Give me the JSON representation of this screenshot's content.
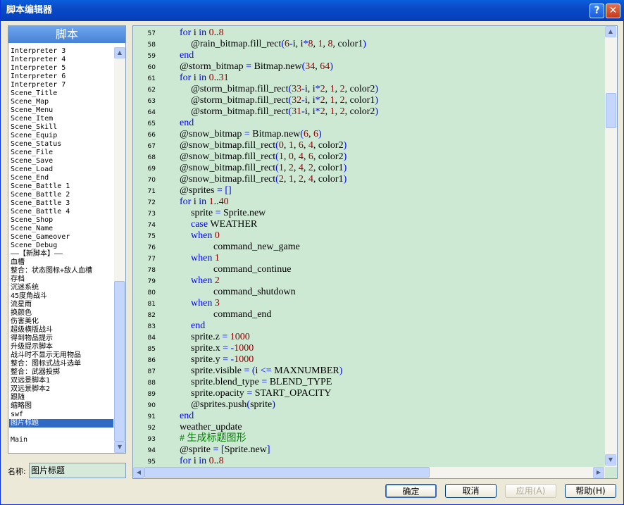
{
  "window": {
    "title": "脚本编辑器",
    "help_icon": "?",
    "close_icon": "✕"
  },
  "script_list": {
    "header": "脚本",
    "items": [
      "Interpreter 3",
      "Interpreter 4",
      "Interpreter 5",
      "Interpreter 6",
      "Interpreter 7",
      "Scene_Title",
      "Scene_Map",
      "Scene_Menu",
      "Scene_Item",
      "Scene_Skill",
      "Scene_Equip",
      "Scene_Status",
      "Scene_File",
      "Scene_Save",
      "Scene_Load",
      "Scene_End",
      "Scene_Battle 1",
      "Scene_Battle 2",
      "Scene_Battle 3",
      "Scene_Battle 4",
      "Scene_Shop",
      "Scene_Name",
      "Scene_Gameover",
      "Scene_Debug",
      "——【新脚本】——",
      "血槽",
      "整合：状态图标+敌人血槽",
      "存档",
      "沉迷系统",
      "45度角战斗",
      "流星雨",
      "换颜色",
      "伤害美化",
      "超级横版战斗",
      "得到物品提示",
      "升级提示脚本",
      "战斗时不显示无用物品",
      "整合：图标式战斗选单",
      "整合：武器投掷",
      "双远景脚本1",
      "双远景脚本2",
      "跟随",
      "缩略图",
      "swf",
      "图片标题",
      "",
      "Main"
    ],
    "selected_index": 44
  },
  "name_field": {
    "label": "名称:",
    "value": "图片标题"
  },
  "code": {
    "lines": [
      {
        "n": "57",
        "indent": 1,
        "segs": [
          [
            "kw",
            "for"
          ],
          [
            "t",
            " i "
          ],
          [
            "kw",
            "in"
          ],
          [
            "num",
            " 0"
          ],
          [
            "t",
            ".."
          ],
          [
            "num",
            "8"
          ]
        ]
      },
      {
        "n": "58",
        "indent": 2,
        "segs": [
          [
            "t",
            "@rain_bitmap.fill_rect"
          ],
          [
            "p",
            "("
          ],
          [
            "num",
            "6"
          ],
          [
            "op",
            "-"
          ],
          [
            "t",
            "i, i"
          ],
          [
            "op",
            "*"
          ],
          [
            "num",
            "8"
          ],
          [
            "t",
            ", "
          ],
          [
            "num",
            "1"
          ],
          [
            "t",
            ", "
          ],
          [
            "num",
            "8"
          ],
          [
            "t",
            ", color1"
          ],
          [
            "p",
            ")"
          ]
        ]
      },
      {
        "n": "59",
        "indent": 1,
        "segs": [
          [
            "kw",
            "end"
          ]
        ]
      },
      {
        "n": "60",
        "indent": 1,
        "segs": [
          [
            "t",
            "@storm_bitmap "
          ],
          [
            "op",
            "="
          ],
          [
            "t",
            " Bitmap.new"
          ],
          [
            "p",
            "("
          ],
          [
            "num",
            "34"
          ],
          [
            "t",
            ", "
          ],
          [
            "num",
            "64"
          ],
          [
            "p",
            ")"
          ]
        ]
      },
      {
        "n": "61",
        "indent": 1,
        "segs": [
          [
            "kw",
            "for"
          ],
          [
            "t",
            " i "
          ],
          [
            "kw",
            "in"
          ],
          [
            "num",
            " 0"
          ],
          [
            "t",
            ".."
          ],
          [
            "num",
            "31"
          ]
        ]
      },
      {
        "n": "62",
        "indent": 2,
        "segs": [
          [
            "t",
            "@storm_bitmap.fill_rect"
          ],
          [
            "p",
            "("
          ],
          [
            "num",
            "33"
          ],
          [
            "op",
            "-"
          ],
          [
            "t",
            "i, i"
          ],
          [
            "op",
            "*"
          ],
          [
            "num",
            "2"
          ],
          [
            "t",
            ", "
          ],
          [
            "num",
            "1"
          ],
          [
            "t",
            ", "
          ],
          [
            "num",
            "2"
          ],
          [
            "t",
            ", color2"
          ],
          [
            "p",
            ")"
          ]
        ]
      },
      {
        "n": "63",
        "indent": 2,
        "segs": [
          [
            "t",
            "@storm_bitmap.fill_rect"
          ],
          [
            "p",
            "("
          ],
          [
            "num",
            "32"
          ],
          [
            "op",
            "-"
          ],
          [
            "t",
            "i, i"
          ],
          [
            "op",
            "*"
          ],
          [
            "num",
            "2"
          ],
          [
            "t",
            ", "
          ],
          [
            "num",
            "1"
          ],
          [
            "t",
            ", "
          ],
          [
            "num",
            "2"
          ],
          [
            "t",
            ", color1"
          ],
          [
            "p",
            ")"
          ]
        ]
      },
      {
        "n": "64",
        "indent": 2,
        "segs": [
          [
            "t",
            "@storm_bitmap.fill_rect"
          ],
          [
            "p",
            "("
          ],
          [
            "num",
            "31"
          ],
          [
            "op",
            "-"
          ],
          [
            "t",
            "i, i"
          ],
          [
            "op",
            "*"
          ],
          [
            "num",
            "2"
          ],
          [
            "t",
            ", "
          ],
          [
            "num",
            "1"
          ],
          [
            "t",
            ", "
          ],
          [
            "num",
            "2"
          ],
          [
            "t",
            ", color2"
          ],
          [
            "p",
            ")"
          ]
        ]
      },
      {
        "n": "65",
        "indent": 1,
        "segs": [
          [
            "kw",
            "end"
          ]
        ]
      },
      {
        "n": "66",
        "indent": 1,
        "segs": [
          [
            "t",
            "@snow_bitmap "
          ],
          [
            "op",
            "="
          ],
          [
            "t",
            " Bitmap.new"
          ],
          [
            "p",
            "("
          ],
          [
            "num",
            "6"
          ],
          [
            "t",
            ", "
          ],
          [
            "num",
            "6"
          ],
          [
            "p",
            ")"
          ]
        ]
      },
      {
        "n": "67",
        "indent": 1,
        "segs": [
          [
            "t",
            "@snow_bitmap.fill_rect"
          ],
          [
            "p",
            "("
          ],
          [
            "num",
            "0"
          ],
          [
            "t",
            ", "
          ],
          [
            "num",
            "1"
          ],
          [
            "t",
            ", "
          ],
          [
            "num",
            "6"
          ],
          [
            "t",
            ", "
          ],
          [
            "num",
            "4"
          ],
          [
            "t",
            ", color2"
          ],
          [
            "p",
            ")"
          ]
        ]
      },
      {
        "n": "68",
        "indent": 1,
        "segs": [
          [
            "t",
            "@snow_bitmap.fill_rect"
          ],
          [
            "p",
            "("
          ],
          [
            "num",
            "1"
          ],
          [
            "t",
            ", "
          ],
          [
            "num",
            "0"
          ],
          [
            "t",
            ", "
          ],
          [
            "num",
            "4"
          ],
          [
            "t",
            ", "
          ],
          [
            "num",
            "6"
          ],
          [
            "t",
            ", color2"
          ],
          [
            "p",
            ")"
          ]
        ]
      },
      {
        "n": "69",
        "indent": 1,
        "segs": [
          [
            "t",
            "@snow_bitmap.fill_rect"
          ],
          [
            "p",
            "("
          ],
          [
            "num",
            "1"
          ],
          [
            "t",
            ", "
          ],
          [
            "num",
            "2"
          ],
          [
            "t",
            ", "
          ],
          [
            "num",
            "4"
          ],
          [
            "t",
            ", "
          ],
          [
            "num",
            "2"
          ],
          [
            "t",
            ", color1"
          ],
          [
            "p",
            ")"
          ]
        ]
      },
      {
        "n": "70",
        "indent": 1,
        "segs": [
          [
            "t",
            "@snow_bitmap.fill_rect"
          ],
          [
            "p",
            "("
          ],
          [
            "num",
            "2"
          ],
          [
            "t",
            ", "
          ],
          [
            "num",
            "1"
          ],
          [
            "t",
            ", "
          ],
          [
            "num",
            "2"
          ],
          [
            "t",
            ", "
          ],
          [
            "num",
            "4"
          ],
          [
            "t",
            ", color1"
          ],
          [
            "p",
            ")"
          ]
        ]
      },
      {
        "n": "71",
        "indent": 1,
        "segs": [
          [
            "t",
            "@sprites "
          ],
          [
            "op",
            "="
          ],
          [
            "p",
            " []"
          ]
        ]
      },
      {
        "n": "72",
        "indent": 1,
        "segs": [
          [
            "kw",
            "for"
          ],
          [
            "t",
            " i "
          ],
          [
            "kw",
            "in"
          ],
          [
            "num",
            " 1"
          ],
          [
            "t",
            ".."
          ],
          [
            "num",
            "40"
          ]
        ]
      },
      {
        "n": "73",
        "indent": 2,
        "segs": [
          [
            "t",
            "sprite "
          ],
          [
            "op",
            "="
          ],
          [
            "t",
            " Sprite.new"
          ]
        ]
      },
      {
        "n": "74",
        "indent": 2,
        "segs": [
          [
            "kw",
            "case"
          ],
          [
            "t",
            " WEATHER"
          ]
        ]
      },
      {
        "n": "75",
        "indent": 2,
        "segs": [
          [
            "kw",
            "when"
          ],
          [
            "num",
            " 0"
          ]
        ]
      },
      {
        "n": "76",
        "indent": 4,
        "segs": [
          [
            "t",
            "command_new_game"
          ]
        ]
      },
      {
        "n": "77",
        "indent": 2,
        "segs": [
          [
            "kw",
            "when"
          ],
          [
            "num",
            " 1"
          ]
        ]
      },
      {
        "n": "78",
        "indent": 4,
        "segs": [
          [
            "t",
            "command_continue"
          ]
        ]
      },
      {
        "n": "79",
        "indent": 2,
        "segs": [
          [
            "kw",
            "when"
          ],
          [
            "num",
            " 2"
          ]
        ]
      },
      {
        "n": "80",
        "indent": 4,
        "segs": [
          [
            "t",
            "command_shutdown"
          ]
        ]
      },
      {
        "n": "81",
        "indent": 2,
        "segs": [
          [
            "kw",
            "when"
          ],
          [
            "num",
            " 3"
          ]
        ]
      },
      {
        "n": "82",
        "indent": 4,
        "segs": [
          [
            "t",
            "command_end"
          ]
        ]
      },
      {
        "n": "83",
        "indent": 2,
        "segs": [
          [
            "kw",
            "end"
          ]
        ]
      },
      {
        "n": "84",
        "indent": 2,
        "segs": [
          [
            "t",
            "sprite.z "
          ],
          [
            "op",
            "="
          ],
          [
            "num",
            " 1000"
          ]
        ]
      },
      {
        "n": "85",
        "indent": 2,
        "segs": [
          [
            "t",
            "sprite.x "
          ],
          [
            "op",
            "="
          ],
          [
            "op",
            " -"
          ],
          [
            "num",
            "1000"
          ]
        ]
      },
      {
        "n": "86",
        "indent": 2,
        "segs": [
          [
            "t",
            "sprite.y "
          ],
          [
            "op",
            "="
          ],
          [
            "op",
            " -"
          ],
          [
            "num",
            "1000"
          ]
        ]
      },
      {
        "n": "87",
        "indent": 2,
        "segs": [
          [
            "t",
            "sprite.visible "
          ],
          [
            "op",
            "="
          ],
          [
            "p",
            " ("
          ],
          [
            "t",
            "i "
          ],
          [
            "op",
            "<="
          ],
          [
            "t",
            " MAXNUMBER"
          ],
          [
            "p",
            ")"
          ]
        ]
      },
      {
        "n": "88",
        "indent": 2,
        "segs": [
          [
            "t",
            "sprite.blend_type "
          ],
          [
            "op",
            "="
          ],
          [
            "t",
            " BLEND_TYPE"
          ]
        ]
      },
      {
        "n": "89",
        "indent": 2,
        "segs": [
          [
            "t",
            "sprite.opacity "
          ],
          [
            "op",
            "="
          ],
          [
            "t",
            " START_OPACITY"
          ]
        ]
      },
      {
        "n": "90",
        "indent": 2,
        "segs": [
          [
            "t",
            "@sprites.push"
          ],
          [
            "p",
            "("
          ],
          [
            "t",
            "sprite"
          ],
          [
            "p",
            ")"
          ]
        ]
      },
      {
        "n": "91",
        "indent": 1,
        "segs": [
          [
            "kw",
            "end"
          ]
        ]
      },
      {
        "n": "92",
        "indent": 1,
        "segs": [
          [
            "t",
            "weather_update"
          ]
        ]
      },
      {
        "n": "93",
        "indent": 1,
        "segs": [
          [
            "cm",
            "# 生成标题图形"
          ]
        ]
      },
      {
        "n": "94",
        "indent": 1,
        "segs": [
          [
            "t",
            "@sprite "
          ],
          [
            "op",
            "="
          ],
          [
            "p",
            " ["
          ],
          [
            "t",
            "Sprite.new"
          ],
          [
            "p",
            "]"
          ]
        ]
      },
      {
        "n": "95",
        "indent": 1,
        "segs": [
          [
            "kw",
            "for"
          ],
          [
            "t",
            " i "
          ],
          [
            "kw",
            "in"
          ],
          [
            "num",
            " 0"
          ],
          [
            "t",
            ".."
          ],
          [
            "num",
            "8"
          ]
        ]
      }
    ]
  },
  "colors": {
    "kw": "#0000ff",
    "num": "#8b0000",
    "op": "#0000ff",
    "p": "#0000ff",
    "t": "#000000",
    "cm": "#008000"
  },
  "buttons": {
    "ok": "确定",
    "cancel": "取消",
    "apply": "应用(A)",
    "help": "帮助(H)"
  }
}
